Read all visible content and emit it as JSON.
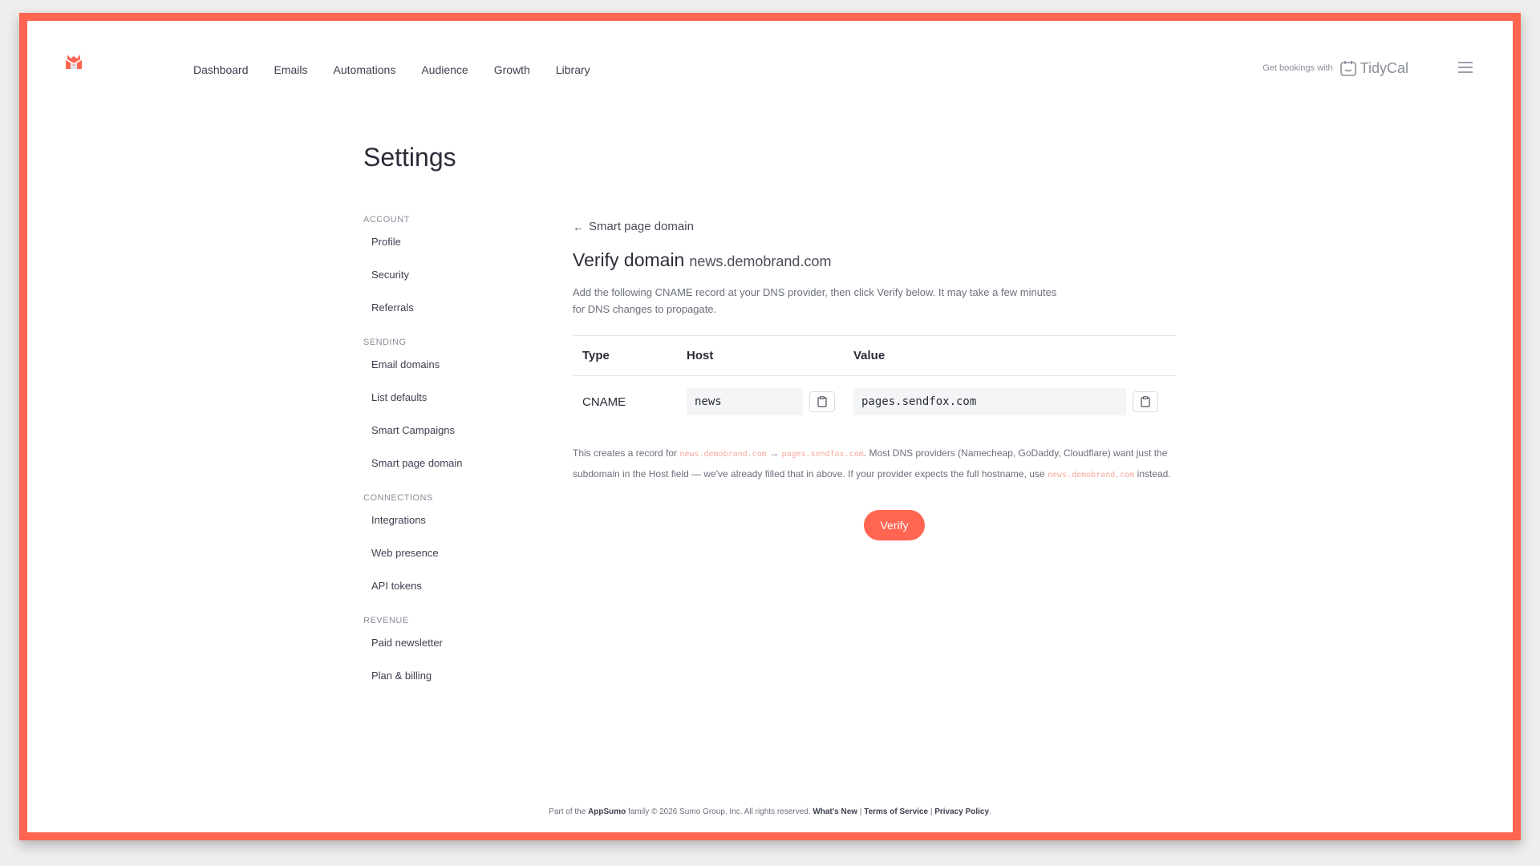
{
  "nav": {
    "items": [
      "Dashboard",
      "Emails",
      "Automations",
      "Audience",
      "Growth",
      "Library"
    ],
    "tidycal_pre": "Get bookings with",
    "tidycal_name": "TidyCal"
  },
  "page": {
    "title": "Settings"
  },
  "sidebar": {
    "sections": [
      {
        "title": "ACCOUNT",
        "items": [
          "Profile",
          "Security",
          "Referrals"
        ]
      },
      {
        "title": "SENDING",
        "items": [
          "Email domains",
          "List defaults",
          "Smart Campaigns",
          "Smart page domain"
        ]
      },
      {
        "title": "CONNECTIONS",
        "items": [
          "Integrations",
          "Web presence",
          "API tokens"
        ]
      },
      {
        "title": "REVENUE",
        "items": [
          "Paid newsletter",
          "Plan & billing"
        ]
      }
    ]
  },
  "main": {
    "back_label": "Smart page domain",
    "heading": "Verify domain",
    "domain": "news.demobrand.com",
    "description": "Add the following CNAME record at your DNS provider, then click Verify below. It may take a few minutes for DNS changes to propagate.",
    "table": {
      "headers": {
        "type": "Type",
        "host": "Host",
        "value": "Value"
      },
      "row": {
        "type": "CNAME",
        "host": "news",
        "value": "pages.sendfox.com"
      }
    },
    "note": {
      "part1": "This creates a record for ",
      "code1": "news.demobrand.com",
      "arrow": " → ",
      "code2": "pages.sendfox.com",
      "part2": ". Most DNS providers (Namecheap, GoDaddy, Cloudflare) want just the subdomain in the Host field — we've already filled that in above. If your provider expects the full hostname, use ",
      "code3": "news.demobrand.com",
      "part3": " instead."
    },
    "verify_label": "Verify"
  },
  "footer": {
    "pre": "Part of the ",
    "appsumo": "AppSumo",
    "mid": " family  © 2026 Sumo Group, Inc. All rights reserved. ",
    "whats_new": "What's New",
    "sep": " | ",
    "terms": "Terms of Service",
    "privacy": "Privacy Policy",
    "end": "."
  },
  "colors": {
    "accent": "#ff6550",
    "frame": "#ff6550",
    "code_highlight": "#f5a99e"
  }
}
